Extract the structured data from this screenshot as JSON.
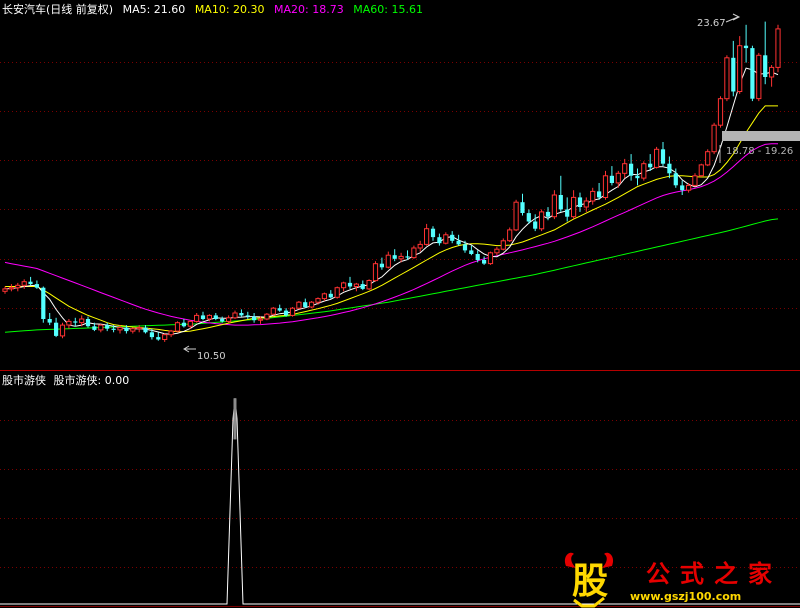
{
  "legend": {
    "title": "长安汽车(日线 前复权)",
    "ma5": "MA5: 21.60",
    "ma10": "MA10: 20.30",
    "ma20": "MA20: 18.73",
    "ma60": "MA60: 15.61"
  },
  "indicator_legend": {
    "name": "股市游侠",
    "value_label": "股市游侠: 0.00"
  },
  "annotations": {
    "high_label": "23.67",
    "low_label": "10.50",
    "range_label": "18.78 - 19.26"
  },
  "watermark": {
    "logo_char": "股",
    "name": [
      "公",
      "式",
      "之",
      "家"
    ],
    "url": "www.gszj100.com"
  },
  "colors": {
    "up": "#ff3232",
    "down": "#54ffff",
    "ma5": "#ffffff",
    "ma10": "#ffff00",
    "ma20": "#ff00ff",
    "ma60": "#00ff00",
    "grid": "#7a0000",
    "indicator": "#ffffff",
    "watermark_red": "#e60000",
    "watermark_yellow": "#ffd800"
  },
  "chart_data": [
    {
      "type": "candlestick",
      "title": "长安汽车(日线 前复权)",
      "ylim": [
        9.5,
        24.2
      ],
      "annotations": [
        "23.67",
        "10.50",
        "18.78 - 19.26"
      ],
      "ohlc": [
        [
          12.6,
          12.8,
          12.5,
          12.7
        ],
        [
          12.7,
          12.9,
          12.6,
          12.75
        ],
        [
          12.75,
          12.95,
          12.6,
          12.85
        ],
        [
          12.85,
          13.1,
          12.7,
          13.0
        ],
        [
          13.0,
          13.2,
          12.85,
          12.9
        ],
        [
          12.9,
          13.05,
          12.7,
          12.75
        ],
        [
          12.75,
          12.8,
          11.3,
          11.45
        ],
        [
          11.45,
          11.7,
          11.2,
          11.3
        ],
        [
          11.3,
          11.5,
          10.7,
          10.75
        ],
        [
          10.75,
          11.3,
          10.65,
          11.2
        ],
        [
          11.2,
          11.45,
          11.05,
          11.35
        ],
        [
          11.35,
          11.5,
          11.15,
          11.3
        ],
        [
          11.3,
          11.6,
          11.15,
          11.45
        ],
        [
          11.45,
          11.55,
          11.1,
          11.15
        ],
        [
          11.15,
          11.3,
          10.95,
          11.0
        ],
        [
          11.0,
          11.25,
          10.9,
          11.2
        ],
        [
          11.2,
          11.3,
          10.95,
          11.05
        ],
        [
          11.05,
          11.2,
          10.9,
          11.0
        ],
        [
          11.0,
          11.2,
          10.85,
          11.1
        ],
        [
          11.1,
          11.2,
          10.85,
          10.95
        ],
        [
          10.95,
          11.1,
          10.85,
          11.05
        ],
        [
          11.05,
          11.2,
          10.9,
          11.1
        ],
        [
          11.1,
          11.2,
          10.85,
          10.9
        ],
        [
          10.9,
          11.05,
          10.6,
          10.7
        ],
        [
          10.7,
          10.9,
          10.55,
          10.6
        ],
        [
          10.6,
          10.85,
          10.5,
          10.8
        ],
        [
          10.8,
          11.0,
          10.7,
          10.95
        ],
        [
          10.95,
          11.35,
          10.9,
          11.3
        ],
        [
          11.3,
          11.45,
          11.1,
          11.15
        ],
        [
          11.15,
          11.4,
          11.05,
          11.35
        ],
        [
          11.35,
          11.7,
          11.3,
          11.6
        ],
        [
          11.6,
          11.75,
          11.4,
          11.45
        ],
        [
          11.45,
          11.65,
          11.35,
          11.6
        ],
        [
          11.6,
          11.7,
          11.4,
          11.45
        ],
        [
          11.45,
          11.55,
          11.3,
          11.35
        ],
        [
          11.35,
          11.6,
          11.3,
          11.5
        ],
        [
          11.5,
          11.8,
          11.45,
          11.7
        ],
        [
          11.7,
          11.85,
          11.55,
          11.6
        ],
        [
          11.6,
          11.75,
          11.45,
          11.55
        ],
        [
          11.55,
          11.7,
          11.3,
          11.4
        ],
        [
          11.4,
          11.55,
          11.25,
          11.45
        ],
        [
          11.45,
          11.7,
          11.4,
          11.65
        ],
        [
          11.65,
          11.95,
          11.6,
          11.9
        ],
        [
          11.9,
          12.05,
          11.75,
          11.8
        ],
        [
          11.8,
          11.9,
          11.55,
          11.6
        ],
        [
          11.6,
          11.95,
          11.55,
          11.9
        ],
        [
          11.9,
          12.2,
          11.85,
          12.15
        ],
        [
          12.15,
          12.3,
          11.9,
          11.95
        ],
        [
          11.95,
          12.2,
          11.9,
          12.15
        ],
        [
          12.15,
          12.35,
          12.05,
          12.3
        ],
        [
          12.3,
          12.55,
          12.2,
          12.5
        ],
        [
          12.5,
          12.65,
          12.3,
          12.35
        ],
        [
          12.35,
          12.8,
          12.3,
          12.75
        ],
        [
          12.75,
          13.0,
          12.6,
          12.95
        ],
        [
          12.95,
          13.2,
          12.7,
          12.8
        ],
        [
          12.8,
          12.95,
          12.6,
          12.9
        ],
        [
          12.9,
          13.05,
          12.65,
          12.7
        ],
        [
          12.7,
          13.1,
          12.65,
          13.05
        ],
        [
          13.05,
          13.85,
          13.0,
          13.75
        ],
        [
          13.75,
          14.0,
          13.5,
          13.6
        ],
        [
          13.6,
          14.25,
          13.55,
          14.1
        ],
        [
          14.1,
          14.35,
          13.85,
          13.95
        ],
        [
          13.95,
          14.2,
          13.8,
          14.05
        ],
        [
          14.05,
          14.3,
          13.9,
          14.0
        ],
        [
          14.0,
          14.5,
          13.95,
          14.4
        ],
        [
          14.4,
          14.7,
          14.25,
          14.55
        ],
        [
          14.55,
          15.4,
          14.5,
          15.2
        ],
        [
          15.2,
          15.3,
          14.7,
          14.85
        ],
        [
          14.85,
          15.0,
          14.5,
          14.6
        ],
        [
          14.6,
          15.05,
          14.55,
          14.95
        ],
        [
          14.95,
          15.1,
          14.6,
          14.7
        ],
        [
          14.7,
          14.95,
          14.5,
          14.55
        ],
        [
          14.55,
          14.7,
          14.2,
          14.3
        ],
        [
          14.3,
          14.5,
          14.1,
          14.15
        ],
        [
          14.15,
          14.3,
          13.8,
          13.9
        ],
        [
          13.9,
          14.05,
          13.7,
          13.75
        ],
        [
          13.75,
          14.25,
          13.7,
          14.2
        ],
        [
          14.2,
          14.45,
          14.1,
          14.35
        ],
        [
          14.35,
          14.8,
          14.3,
          14.7
        ],
        [
          14.7,
          15.25,
          14.65,
          15.15
        ],
        [
          15.15,
          16.4,
          15.1,
          16.3
        ],
        [
          16.3,
          16.65,
          15.75,
          15.85
        ],
        [
          15.85,
          16.0,
          15.4,
          15.5
        ],
        [
          15.5,
          15.8,
          15.1,
          15.2
        ],
        [
          15.2,
          16.0,
          15.1,
          15.9
        ],
        [
          15.9,
          16.1,
          15.55,
          15.7
        ],
        [
          15.7,
          16.8,
          15.6,
          16.6
        ],
        [
          16.6,
          17.4,
          15.9,
          16.0
        ],
        [
          16.0,
          16.5,
          15.5,
          15.7
        ],
        [
          15.7,
          16.8,
          15.6,
          16.5
        ],
        [
          16.5,
          16.7,
          15.9,
          16.1
        ],
        [
          16.1,
          16.5,
          15.9,
          16.35
        ],
        [
          16.35,
          16.9,
          16.2,
          16.75
        ],
        [
          16.75,
          17.1,
          16.4,
          16.5
        ],
        [
          16.5,
          17.6,
          16.4,
          17.4
        ],
        [
          17.4,
          17.8,
          17.0,
          17.1
        ],
        [
          17.1,
          17.6,
          16.9,
          17.5
        ],
        [
          17.5,
          18.1,
          17.3,
          17.9
        ],
        [
          17.9,
          18.3,
          17.2,
          17.4
        ],
        [
          17.4,
          17.7,
          17.0,
          17.3
        ],
        [
          17.3,
          18.0,
          17.2,
          17.9
        ],
        [
          17.9,
          18.3,
          17.6,
          17.75
        ],
        [
          17.75,
          18.6,
          17.7,
          18.5
        ],
        [
          18.5,
          18.8,
          17.8,
          17.9
        ],
        [
          17.9,
          18.2,
          17.3,
          17.5
        ],
        [
          17.5,
          17.7,
          16.9,
          17.0
        ],
        [
          17.0,
          17.2,
          16.6,
          16.8
        ],
        [
          16.8,
          17.1,
          16.7,
          17.0
        ],
        [
          17.0,
          17.5,
          16.95,
          17.4
        ],
        [
          17.4,
          17.9,
          17.35,
          17.85
        ],
        [
          17.85,
          18.5,
          17.8,
          18.4
        ],
        [
          18.4,
          19.6,
          18.3,
          19.5
        ],
        [
          19.5,
          20.7,
          19.4,
          20.6
        ],
        [
          20.6,
          22.4,
          20.5,
          22.3
        ],
        [
          22.3,
          23.0,
          20.7,
          20.9
        ],
        [
          20.9,
          23.2,
          20.8,
          22.8
        ],
        [
          22.8,
          23.67,
          22.1,
          22.7
        ],
        [
          22.7,
          22.8,
          20.5,
          20.6
        ],
        [
          20.6,
          22.5,
          20.5,
          22.4
        ],
        [
          22.4,
          23.8,
          21.2,
          21.5
        ],
        [
          21.5,
          22.0,
          21.1,
          21.9
        ],
        [
          21.9,
          23.67,
          21.7,
          23.5
        ]
      ],
      "ma5": [
        12.7,
        12.72,
        12.75,
        12.8,
        12.84,
        12.85,
        12.55,
        12.27,
        11.85,
        11.5,
        11.2,
        11.15,
        11.2,
        11.3,
        11.25,
        11.24,
        11.2,
        11.15,
        11.1,
        11.05,
        11.04,
        11.05,
        11.03,
        10.98,
        10.91,
        10.84,
        10.82,
        10.86,
        10.94,
        11.06,
        11.23,
        11.33,
        11.42,
        11.5,
        11.48,
        11.48,
        11.52,
        11.53,
        11.55,
        11.55,
        11.54,
        11.53,
        11.6,
        11.67,
        11.7,
        11.75,
        11.85,
        11.92,
        12.0,
        12.1,
        12.2,
        12.27,
        12.41,
        12.56,
        12.66,
        12.75,
        12.82,
        12.87,
        13.05,
        13.2,
        13.45,
        13.68,
        13.84,
        13.92,
        14.09,
        14.2,
        14.44,
        14.61,
        14.64,
        14.83,
        14.87,
        14.73,
        14.62,
        14.53,
        14.33,
        14.15,
        14.05,
        14.04,
        14.19,
        14.44,
        14.87,
        15.18,
        15.44,
        15.63,
        15.75,
        15.63,
        15.8,
        15.88,
        15.95,
        16.1,
        16.19,
        16.25,
        16.38,
        16.44,
        16.62,
        16.8,
        16.96,
        17.28,
        17.46,
        17.44,
        17.56,
        17.64,
        17.78,
        17.77,
        17.71,
        17.53,
        17.23,
        17.04,
        16.94,
        17.03,
        17.3,
        17.83,
        18.58,
        19.43,
        20.32,
        21.21,
        21.87,
        21.8,
        21.62,
        21.64,
        21.7,
        21.6
      ],
      "ma10": [
        12.8,
        12.8,
        12.8,
        12.8,
        12.8,
        12.8,
        12.65,
        12.5,
        12.32,
        12.15,
        11.98,
        11.85,
        11.72,
        11.6,
        11.5,
        11.4,
        11.3,
        11.22,
        11.18,
        11.15,
        11.12,
        11.1,
        11.08,
        11.05,
        11.02,
        10.98,
        10.95,
        10.93,
        10.93,
        10.95,
        11.0,
        11.05,
        11.1,
        11.16,
        11.22,
        11.28,
        11.33,
        11.38,
        11.43,
        11.48,
        11.5,
        11.52,
        11.55,
        11.58,
        11.6,
        11.64,
        11.7,
        11.76,
        11.82,
        11.88,
        11.95,
        12.02,
        12.1,
        12.2,
        12.3,
        12.4,
        12.5,
        12.6,
        12.72,
        12.85,
        13.0,
        13.15,
        13.3,
        13.45,
        13.6,
        13.75,
        13.9,
        14.05,
        14.2,
        14.32,
        14.42,
        14.5,
        14.55,
        14.58,
        14.58,
        14.56,
        14.53,
        14.5,
        14.5,
        14.52,
        14.58,
        14.65,
        14.75,
        14.85,
        14.95,
        15.05,
        15.15,
        15.3,
        15.45,
        15.6,
        15.72,
        15.85,
        15.98,
        16.1,
        16.22,
        16.36,
        16.5,
        16.65,
        16.8,
        16.95,
        17.05,
        17.15,
        17.25,
        17.32,
        17.38,
        17.4,
        17.4,
        17.38,
        17.36,
        17.35,
        17.35,
        17.45,
        17.65,
        17.95,
        18.3,
        18.75,
        19.2,
        19.6,
        20.0,
        20.3,
        20.3,
        20.3
      ],
      "ma20": [
        13.8,
        13.75,
        13.7,
        13.65,
        13.6,
        13.55,
        13.45,
        13.35,
        13.25,
        13.15,
        13.05,
        12.95,
        12.85,
        12.75,
        12.65,
        12.55,
        12.45,
        12.35,
        12.25,
        12.15,
        12.05,
        11.95,
        11.86,
        11.78,
        11.7,
        11.63,
        11.56,
        11.5,
        11.45,
        11.4,
        11.36,
        11.32,
        11.29,
        11.26,
        11.24,
        11.22,
        11.2,
        11.2,
        11.2,
        11.21,
        11.22,
        11.24,
        11.26,
        11.28,
        11.31,
        11.34,
        11.38,
        11.42,
        11.46,
        11.5,
        11.55,
        11.6,
        11.66,
        11.72,
        11.78,
        11.85,
        11.92,
        12.0,
        12.08,
        12.17,
        12.26,
        12.36,
        12.46,
        12.57,
        12.68,
        12.8,
        12.92,
        13.05,
        13.18,
        13.31,
        13.44,
        13.56,
        13.68,
        13.78,
        13.87,
        13.95,
        14.02,
        14.08,
        14.14,
        14.2,
        14.26,
        14.32,
        14.39,
        14.46,
        14.53,
        14.6,
        14.68,
        14.77,
        14.86,
        14.96,
        15.06,
        15.17,
        15.28,
        15.4,
        15.52,
        15.64,
        15.76,
        15.88,
        16.0,
        16.12,
        16.24,
        16.36,
        16.48,
        16.58,
        16.66,
        16.72,
        16.77,
        16.82,
        16.88,
        16.95,
        17.05,
        17.18,
        17.35,
        17.55,
        17.78,
        18.02,
        18.25,
        18.45,
        18.6,
        18.7,
        18.73,
        18.73
      ],
      "ma60": [
        10.9,
        10.92,
        10.94,
        10.96,
        10.98,
        11.0,
        11.01,
        11.02,
        11.03,
        11.04,
        11.05,
        11.06,
        11.07,
        11.08,
        11.09,
        11.1,
        11.11,
        11.12,
        11.13,
        11.14,
        11.15,
        11.16,
        11.17,
        11.18,
        11.19,
        11.2,
        11.21,
        11.22,
        11.23,
        11.24,
        11.25,
        11.27,
        11.29,
        11.31,
        11.33,
        11.35,
        11.37,
        11.39,
        11.41,
        11.43,
        11.45,
        11.48,
        11.51,
        11.54,
        11.57,
        11.6,
        11.63,
        11.66,
        11.69,
        11.72,
        11.75,
        11.79,
        11.83,
        11.87,
        11.91,
        11.95,
        11.99,
        12.03,
        12.07,
        12.11,
        12.15,
        12.2,
        12.25,
        12.3,
        12.35,
        12.4,
        12.45,
        12.5,
        12.55,
        12.6,
        12.65,
        12.7,
        12.75,
        12.8,
        12.85,
        12.9,
        12.95,
        13.0,
        13.05,
        13.1,
        13.15,
        13.2,
        13.25,
        13.3,
        13.36,
        13.42,
        13.48,
        13.54,
        13.6,
        13.66,
        13.72,
        13.78,
        13.84,
        13.9,
        13.96,
        14.02,
        14.08,
        14.14,
        14.2,
        14.26,
        14.32,
        14.38,
        14.44,
        14.5,
        14.56,
        14.62,
        14.68,
        14.74,
        14.8,
        14.86,
        14.92,
        14.98,
        15.04,
        15.1,
        15.17,
        15.24,
        15.31,
        15.38,
        15.45,
        15.52,
        15.58,
        15.61
      ]
    },
    {
      "type": "line",
      "title": "股市游侠",
      "series": [
        {
          "name": "股市游侠",
          "peak_index": 36,
          "peak_value": 1.0,
          "current": 0.0
        }
      ],
      "ylim": [
        0,
        1.05
      ]
    }
  ]
}
